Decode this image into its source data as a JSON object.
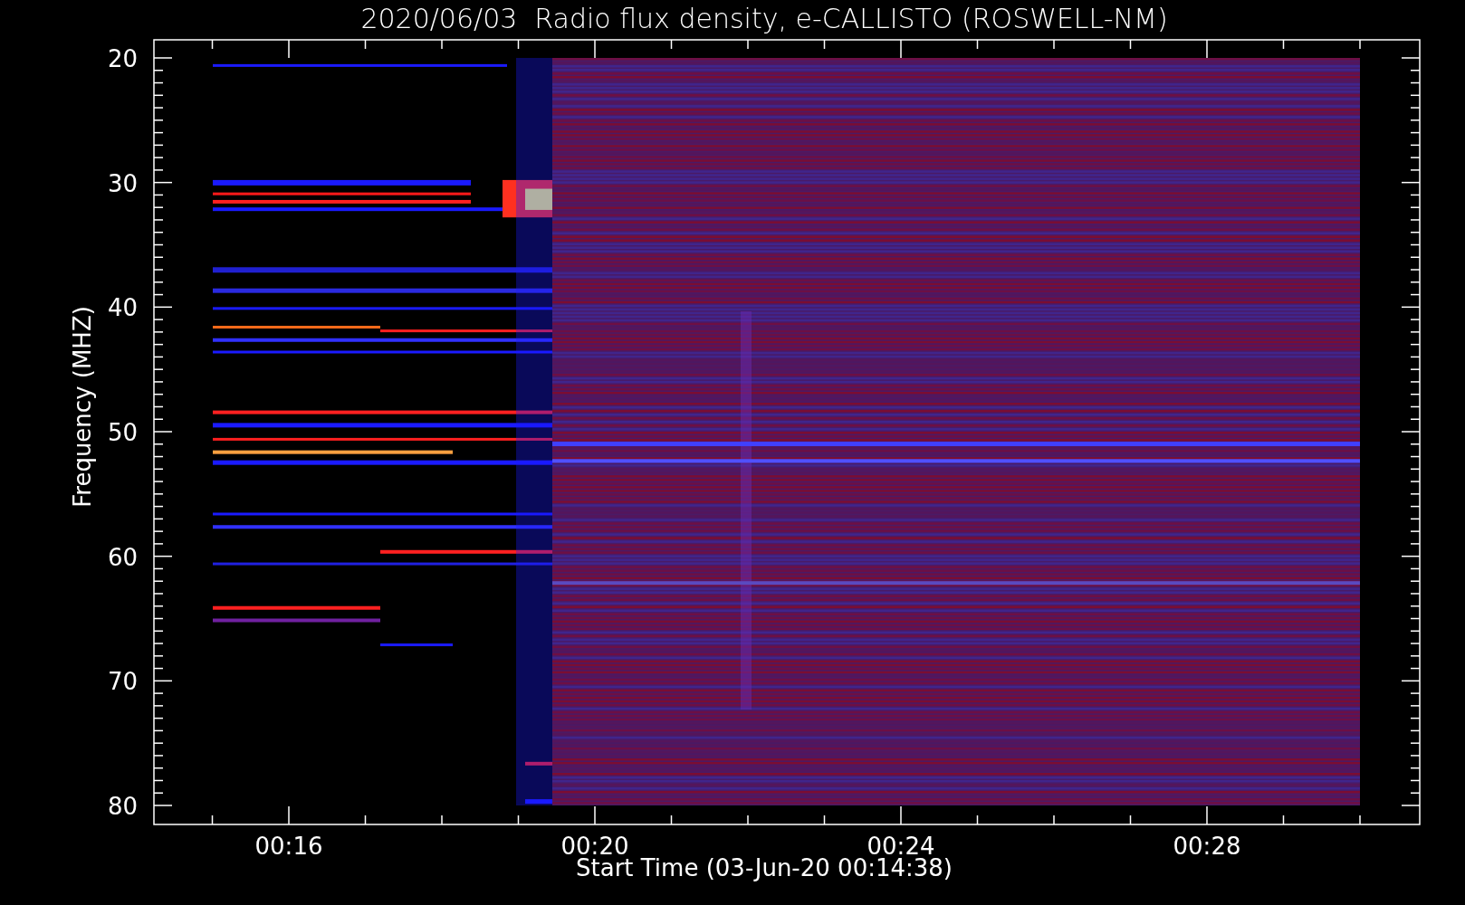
{
  "title": "2020/06/03  Radio flux density, e-CALLISTO (ROSWELL-NM)",
  "ylabel": "Frequency (MHZ)",
  "yticks": [
    "20",
    "30",
    "40",
    "50",
    "60",
    "70",
    "80"
  ],
  "xticks": [
    "00:16",
    "00:20",
    "00:24",
    "00:28"
  ],
  "xlabel": "Start Time (03-Jun-20 00:14:38)"
}
